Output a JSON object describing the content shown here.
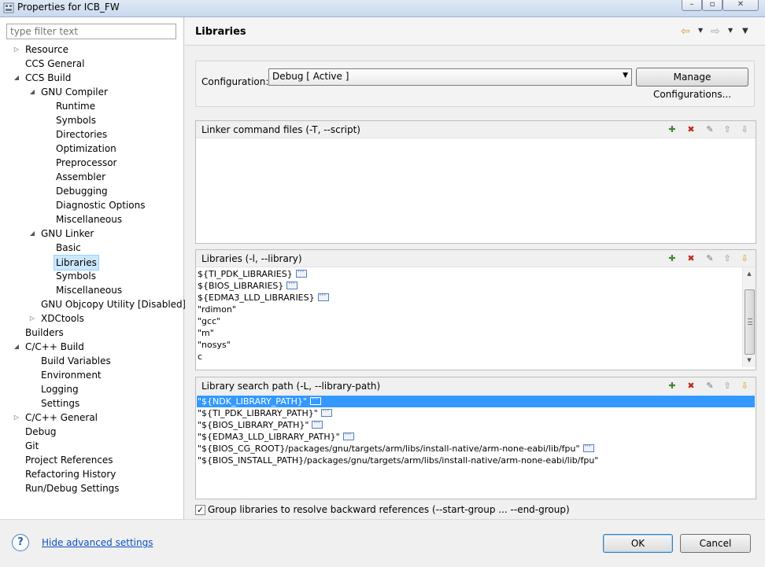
{
  "window": {
    "title": "Properties for ICB_FW",
    "buttons": [
      "minimize-icon",
      "maximize-icon",
      "close-icon"
    ]
  },
  "filter": {
    "placeholder": "type filter text"
  },
  "tree": [
    {
      "label": "Resource",
      "level": 0,
      "twisty": "collapsed"
    },
    {
      "label": "CCS General",
      "level": 0,
      "twisty": "none"
    },
    {
      "label": "CCS Build",
      "level": 0,
      "twisty": "expanded"
    },
    {
      "label": "GNU Compiler",
      "level": 1,
      "twisty": "expanded"
    },
    {
      "label": "Runtime",
      "level": 2,
      "twisty": "none"
    },
    {
      "label": "Symbols",
      "level": 2,
      "twisty": "none"
    },
    {
      "label": "Directories",
      "level": 2,
      "twisty": "none"
    },
    {
      "label": "Optimization",
      "level": 2,
      "twisty": "none"
    },
    {
      "label": "Preprocessor",
      "level": 2,
      "twisty": "none"
    },
    {
      "label": "Assembler",
      "level": 2,
      "twisty": "none"
    },
    {
      "label": "Debugging",
      "level": 2,
      "twisty": "none"
    },
    {
      "label": "Diagnostic Options",
      "level": 2,
      "twisty": "none"
    },
    {
      "label": "Miscellaneous",
      "level": 2,
      "twisty": "none"
    },
    {
      "label": "GNU Linker",
      "level": 1,
      "twisty": "expanded"
    },
    {
      "label": "Basic",
      "level": 2,
      "twisty": "none"
    },
    {
      "label": "Libraries",
      "level": 2,
      "twisty": "none",
      "selected": true
    },
    {
      "label": "Symbols",
      "level": 2,
      "twisty": "none"
    },
    {
      "label": "Miscellaneous",
      "level": 2,
      "twisty": "none"
    },
    {
      "label": "GNU Objcopy Utility  [Disabled]",
      "level": 1,
      "twisty": "none"
    },
    {
      "label": "XDCtools",
      "level": 1,
      "twisty": "collapsed"
    },
    {
      "label": "Builders",
      "level": 0,
      "twisty": "none"
    },
    {
      "label": "C/C++ Build",
      "level": 0,
      "twisty": "expanded"
    },
    {
      "label": "Build Variables",
      "level": 1,
      "twisty": "none"
    },
    {
      "label": "Environment",
      "level": 1,
      "twisty": "none"
    },
    {
      "label": "Logging",
      "level": 1,
      "twisty": "none"
    },
    {
      "label": "Settings",
      "level": 1,
      "twisty": "none"
    },
    {
      "label": "C/C++ General",
      "level": 0,
      "twisty": "collapsed"
    },
    {
      "label": "Debug",
      "level": 0,
      "twisty": "none"
    },
    {
      "label": "Git",
      "level": 0,
      "twisty": "none"
    },
    {
      "label": "Project References",
      "level": 0,
      "twisty": "none"
    },
    {
      "label": "Refactoring History",
      "level": 0,
      "twisty": "none"
    },
    {
      "label": "Run/Debug Settings",
      "level": 0,
      "twisty": "none"
    }
  ],
  "page": {
    "title": "Libraries",
    "back_icon": "back-arrow-icon",
    "forward_icon": "forward-arrow-icon"
  },
  "configuration": {
    "label": "Configuration:",
    "selected": "Debug  [ Active ]",
    "manage_label": "Manage Configurations..."
  },
  "sections": {
    "linker_cmd": {
      "title": "Linker command files (-T, --script)",
      "items": []
    },
    "libraries": {
      "title": "Libraries (-l, --library)",
      "items": [
        {
          "text": "${TI_PDK_LIBRARIES}",
          "has_dots": true
        },
        {
          "text": "${BIOS_LIBRARIES}",
          "has_dots": true
        },
        {
          "text": "${EDMA3_LLD_LIBRARIES}",
          "has_dots": true
        },
        {
          "text": "\"rdimon\"",
          "has_dots": false
        },
        {
          "text": "\"gcc\"",
          "has_dots": false
        },
        {
          "text": "\"m\"",
          "has_dots": false
        },
        {
          "text": "\"nosys\"",
          "has_dots": false
        },
        {
          "text": "c",
          "has_dots": false
        }
      ]
    },
    "search_path": {
      "title": "Library search path (-L, --library-path)",
      "items": [
        {
          "text": "\"${NDK_LIBRARY_PATH}\"",
          "has_dots": true,
          "selected": true
        },
        {
          "text": "\"${TI_PDK_LIBRARY_PATH}\"",
          "has_dots": true
        },
        {
          "text": "\"${BIOS_LIBRARY_PATH}\"",
          "has_dots": true
        },
        {
          "text": "\"${EDMA3_LLD_LIBRARY_PATH}\"",
          "has_dots": true
        },
        {
          "text": "\"${BIOS_CG_ROOT}/packages/gnu/targets/arm/libs/install-native/arm-none-eabi/lib/fpu\"",
          "has_dots": true
        },
        {
          "text": "\"${BIOS_INSTALL_PATH}/packages/gnu/targets/arm/libs/install-native/arm-none-eabi/lib/fpu\"",
          "has_dots": false
        }
      ]
    }
  },
  "group_libraries": {
    "checked": true,
    "label": "Group libraries to resolve backward references (--start-group ... --end-group)"
  },
  "footer": {
    "help_icon": "help-icon",
    "help_glyph": "?",
    "advanced_link": "Hide advanced settings",
    "ok_label": "OK",
    "cancel_label": "Cancel"
  },
  "colors": {
    "selection": "#3399ff",
    "tree_selection": "#cce8ff",
    "link": "#0b50c2"
  }
}
